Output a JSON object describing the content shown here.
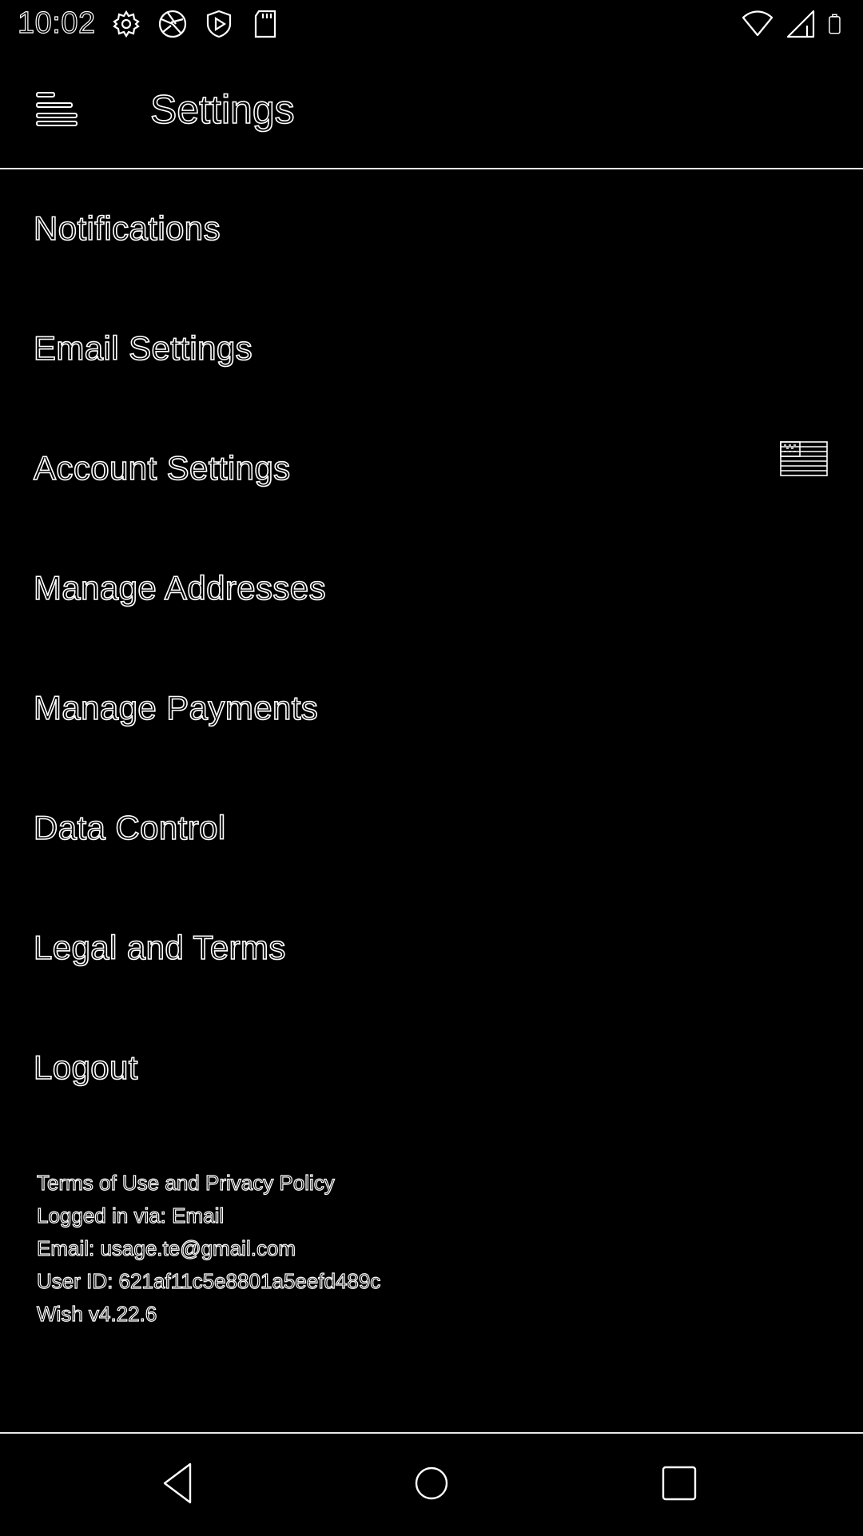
{
  "status_bar": {
    "time": "10:02",
    "left_icons": [
      "settings-gear-icon",
      "camera-shutter-icon",
      "shield-play-icon",
      "sd-card-icon"
    ],
    "right_icons": [
      "wifi-icon",
      "cell-signal-icon",
      "battery-icon"
    ]
  },
  "app_bar": {
    "title": "Settings",
    "menu_icon": "menu-icon"
  },
  "settings": {
    "items": [
      {
        "label": "Notifications"
      },
      {
        "label": "Email Settings"
      },
      {
        "label": "Account Settings",
        "trailing_icon": "us-flag-icon"
      },
      {
        "label": "Manage Addresses"
      },
      {
        "label": "Manage Payments"
      },
      {
        "label": "Data Control"
      },
      {
        "label": "Legal and Terms"
      },
      {
        "label": "Logout"
      }
    ]
  },
  "footer": {
    "terms": "Terms of Use and Privacy Policy",
    "logged_in_via": "Logged in via: Email",
    "email": "Email: usage.te@gmail.com",
    "user_id": "User ID: 621af11c5e8801a5eefd489c",
    "version": "Wish v4.22.6"
  },
  "nav_bar": {
    "icons": [
      "back-icon",
      "home-icon",
      "recents-icon"
    ]
  },
  "colors": {
    "background": "#000000",
    "outline": "#ffffff",
    "divider": "#e8e8e8"
  }
}
